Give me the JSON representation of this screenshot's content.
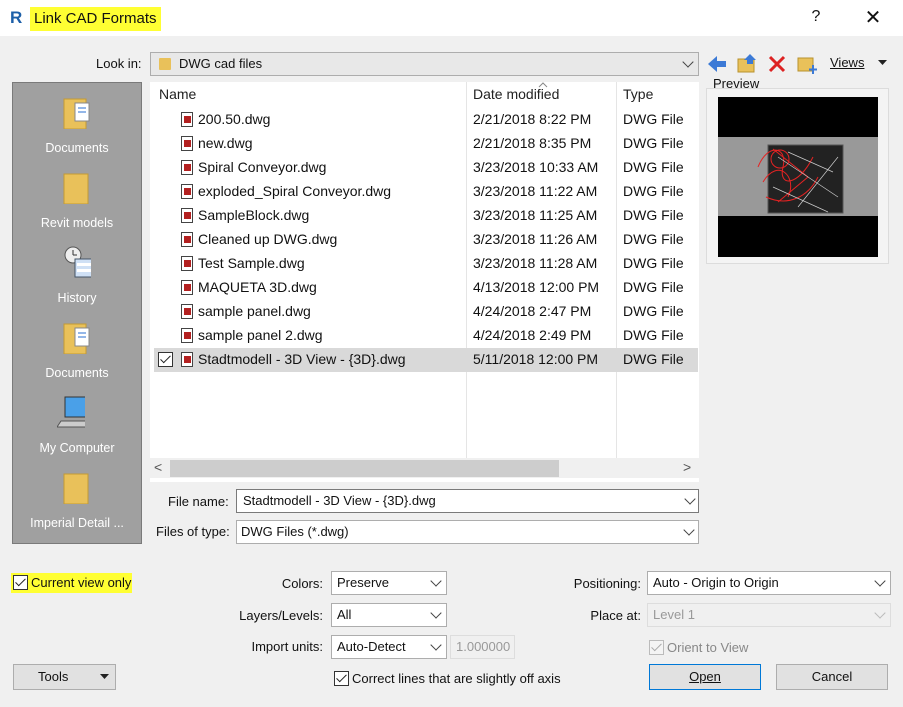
{
  "window": {
    "title": "Link CAD Formats",
    "app_icon": "R",
    "help": "?",
    "close": "✕"
  },
  "look_in": {
    "label": "Look in:",
    "value": "DWG cad files"
  },
  "toolbar": {
    "views_label": "Views"
  },
  "places": [
    {
      "label": "Documents",
      "icon": "documents-folder-icon"
    },
    {
      "label": "Revit models",
      "icon": "folder-icon"
    },
    {
      "label": "History",
      "icon": "history-icon"
    },
    {
      "label": "Documents",
      "icon": "documents-folder-icon"
    },
    {
      "label": "My Computer",
      "icon": "computer-icon"
    },
    {
      "label": "Imperial Detail ...",
      "icon": "folder-icon"
    }
  ],
  "file_list": {
    "columns": [
      "Name",
      "Date modified",
      "Type"
    ],
    "rows": [
      {
        "name": "200.50.dwg",
        "date": "2/21/2018 8:22 PM",
        "type": "DWG File"
      },
      {
        "name": "new.dwg",
        "date": "2/21/2018 8:35 PM",
        "type": "DWG File"
      },
      {
        "name": "Spiral Conveyor.dwg",
        "date": "3/23/2018 10:33 AM",
        "type": "DWG File"
      },
      {
        "name": "exploded_Spiral Conveyor.dwg",
        "date": "3/23/2018 11:22 AM",
        "type": "DWG File"
      },
      {
        "name": "SampleBlock.dwg",
        "date": "3/23/2018 11:25 AM",
        "type": "DWG File"
      },
      {
        "name": "Cleaned up DWG.dwg",
        "date": "3/23/2018 11:26 AM",
        "type": "DWG File"
      },
      {
        "name": "Test Sample.dwg",
        "date": "3/23/2018 11:28 AM",
        "type": "DWG File"
      },
      {
        "name": "MAQUETA 3D.dwg",
        "date": "4/13/2018 12:00 PM",
        "type": "DWG File"
      },
      {
        "name": "sample panel.dwg",
        "date": "4/24/2018 2:47 PM",
        "type": "DWG File"
      },
      {
        "name": "sample panel 2.dwg",
        "date": "4/24/2018 2:49 PM",
        "type": "DWG File"
      },
      {
        "name": "Stadtmodell - 3D View - {3D}.dwg",
        "date": "5/11/2018 12:00 PM",
        "type": "DWG File",
        "selected": true
      }
    ]
  },
  "preview": {
    "label": "Preview"
  },
  "file_name": {
    "label": "File name:",
    "value": "Stadtmodell - 3D View - {3D}.dwg"
  },
  "file_type": {
    "label": "Files of type:",
    "value": "DWG Files  (*.dwg)"
  },
  "options": {
    "current_view_only": {
      "label": "Current view only",
      "checked": true
    },
    "colors": {
      "label": "Colors:",
      "value": "Preserve"
    },
    "layers": {
      "label": "Layers/Levels:",
      "value": "All"
    },
    "import_units": {
      "label": "Import units:",
      "value": "Auto-Detect",
      "scale": "1.000000"
    },
    "correct_lines": {
      "label": "Correct lines that are slightly off axis",
      "checked": true
    },
    "positioning": {
      "label": "Positioning:",
      "value": "Auto - Origin to Origin"
    },
    "place_at": {
      "label": "Place at:",
      "value": "Level 1"
    },
    "orient_to_view": {
      "label": "Orient to View",
      "checked": true
    }
  },
  "buttons": {
    "tools": "Tools",
    "open": "Open",
    "cancel": "Cancel"
  },
  "colors": {
    "highlight": "#ffff33",
    "sidebar": "#a0a0a0",
    "selected_row": "#d9d9d9"
  }
}
